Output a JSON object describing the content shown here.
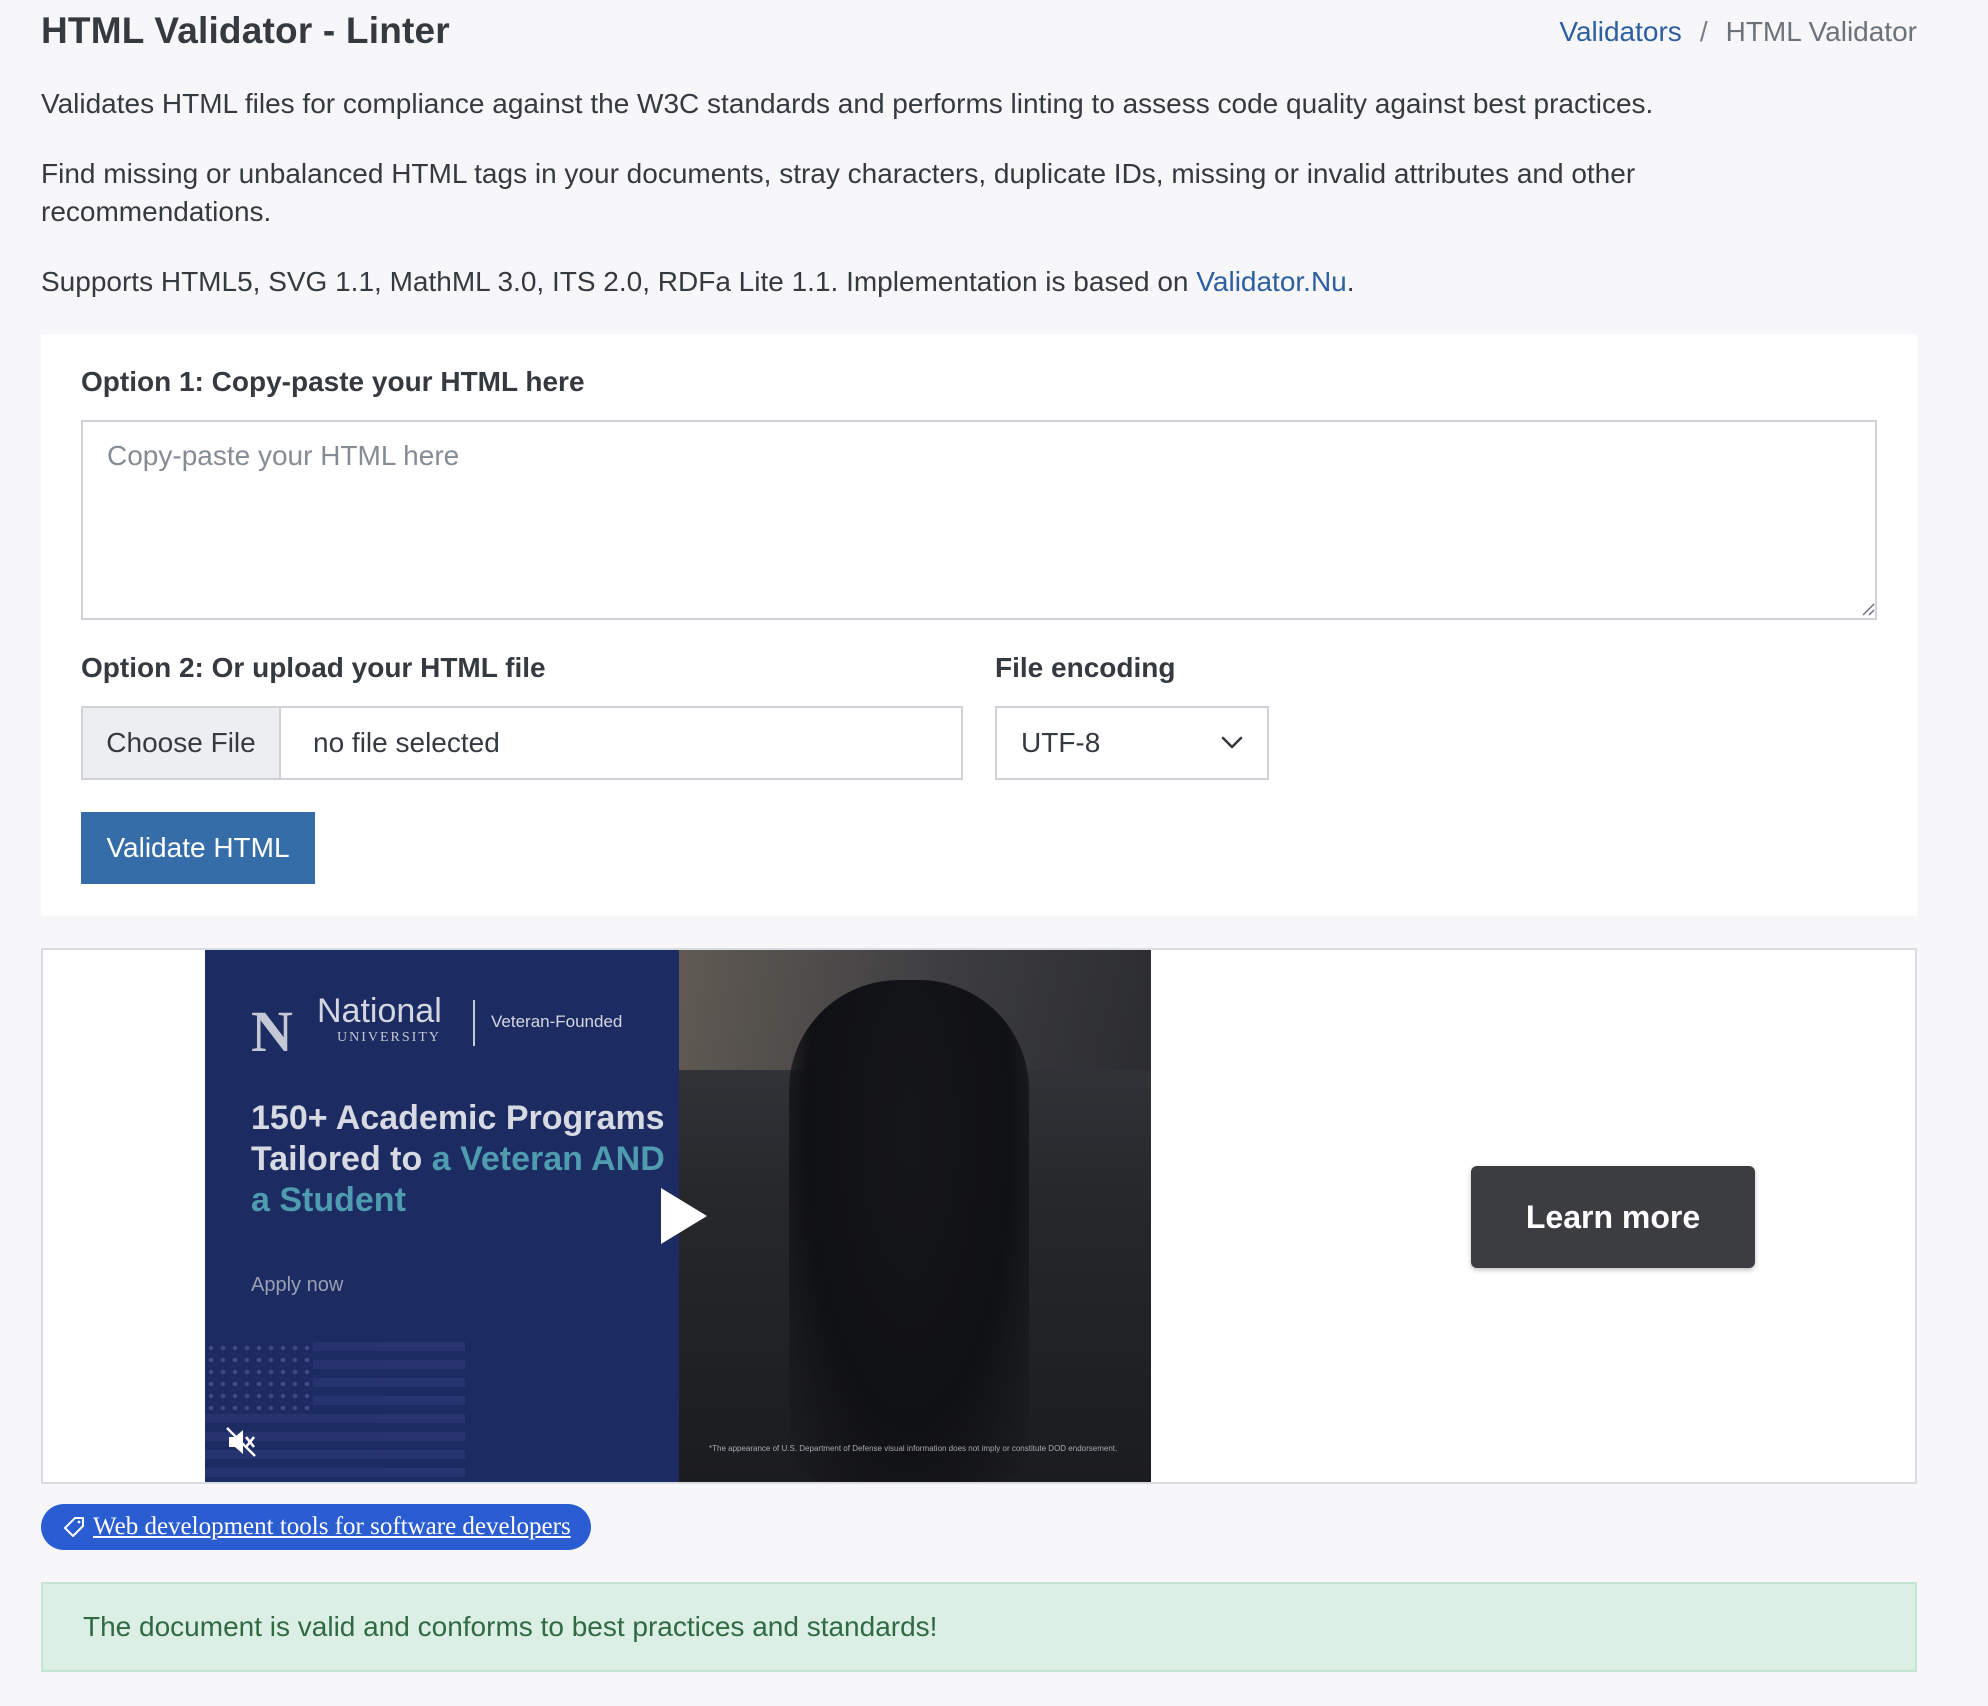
{
  "header": {
    "title": "HTML Validator - Linter",
    "breadcrumb": {
      "parent": "Validators",
      "separator": "/",
      "current": "HTML Validator"
    }
  },
  "intro": {
    "line1": "Validates HTML files for compliance against the W3C standards and performs linting to assess code quality against best practices.",
    "line2": "Find missing or unbalanced HTML tags in your documents, stray characters, duplicate IDs, missing or invalid attributes and other recommendations.",
    "line3_prefix": "Supports HTML5, SVG 1.1, MathML 3.0, ITS 2.0, RDFa Lite 1.1. Implementation is based on ",
    "line3_link": "Validator.Nu",
    "line3_suffix": "."
  },
  "form": {
    "option1_label": "Option 1: Copy-paste your HTML here",
    "textarea_placeholder": "Copy-paste your HTML here",
    "textarea_value": "",
    "option2_label": "Option 2: Or upload your HTML file",
    "choose_file_label": "Choose File",
    "file_status": "no file selected",
    "encoding_label": "File encoding",
    "encoding_value": "UTF-8",
    "validate_label": "Validate HTML"
  },
  "ad": {
    "logo_name": "National",
    "logo_sub": "UNIVERSITY",
    "logo_tag": "Veteran-Founded",
    "headline_main": "150+ Academic Programs Tailored to ",
    "headline_accent": "a Veteran AND a Student",
    "apply": "Apply now",
    "disclaimer": "*The appearance of U.S. Department of Defense visual information does not imply or constitute DOD endorsement.",
    "cta": "Learn more"
  },
  "tag": {
    "label": "Web development tools for software developers",
    "icon": "tag-icon"
  },
  "alert": {
    "message": "The document is valid and conforms to best practices and standards!",
    "color": "#2f6a43"
  },
  "colors": {
    "accent": "#356da8",
    "link": "#2d5fa0",
    "success_bg": "#dcefe4",
    "tag_bg": "#2a5cd2"
  }
}
